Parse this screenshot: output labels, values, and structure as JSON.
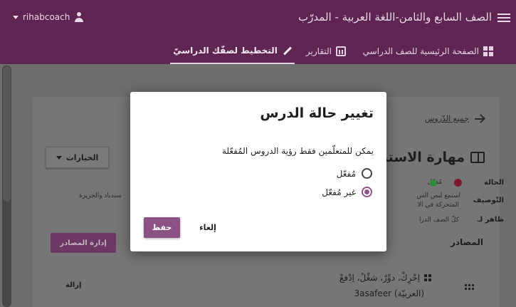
{
  "app": {
    "title": "الصف السابع والثامن-اللغة العربية - المدرّب",
    "user": "rihabcoach"
  },
  "tabs": [
    {
      "label": "الصفحة الرئيسية للصف الدراسي",
      "icon": "dashboard-icon"
    },
    {
      "label": "التقارير",
      "icon": "bar-chart-icon"
    },
    {
      "label": "التخطيط لصفّك الدراسيّ",
      "icon": "pencil-icon",
      "active": true
    }
  ],
  "page": {
    "back_link": "جميع الدّروس",
    "lesson_title": "مهارة الاستد",
    "options_label": "الخيارات",
    "meta": {
      "status_label": "الحالة",
      "status_value": "مُفعّل",
      "description_label": "التّوصيف",
      "description_line1": "استمع لنص الس",
      "description_line2": "المتحركة في الا",
      "description_tail": "ستدباد والجزيرة",
      "visible_to_label": "ظاهر لـ",
      "visible_to_value": "كلّ الصف الدرا"
    },
    "resources": {
      "manage_label": "إدارة المصادر",
      "section_label": "المصادر",
      "items": [
        {
          "title": "اِحْرِكْ، دوِّرْ، شغِّلْ، اِدْفعْ",
          "subtitle": "3asafeer (العربيّة)",
          "remove_label": "إزالة"
        }
      ]
    }
  },
  "dialog": {
    "title": "تغيير حالة الدرس",
    "description": "يمكن للمتعلّمين فقط رؤية الدروس المُفعّلة",
    "options": [
      {
        "label": "مُفعّل",
        "selected": false
      },
      {
        "label": "غير مُفعّل",
        "selected": true
      }
    ],
    "save_label": "حفظ",
    "cancel_label": "إلغاء"
  }
}
